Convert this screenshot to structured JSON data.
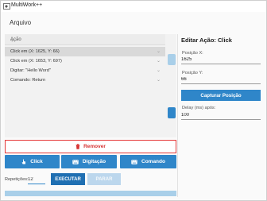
{
  "window": {
    "title": "MultiWork++"
  },
  "menu": {
    "arquivo": "Arquivo"
  },
  "list": {
    "header": "Ação",
    "items": [
      {
        "label": "Click em (X: 1625, Y: 66)",
        "selected": true
      },
      {
        "label": "Click em (X: 1653, Y: 697)",
        "selected": false
      },
      {
        "label": "Digitar: \"Hello Word\"",
        "selected": false
      },
      {
        "label": "Comando: Return",
        "selected": false
      }
    ]
  },
  "actions": {
    "remover": "Remover",
    "click": "Click",
    "digitacao": "Digitação",
    "comando": "Comando"
  },
  "run": {
    "repeticoes_label": "Repetições:",
    "repeticoes_value": "12",
    "executar": "EXECUTAR",
    "parar": "PARAR"
  },
  "editor": {
    "title": "Editar Ação: Click",
    "pos_x_label": "Posição X:",
    "pos_x_value": "1625",
    "pos_y_label": "Posição Y:",
    "pos_y_value": "66",
    "capturar": "Capturar Posição",
    "delay_label": "Delay (ms) após:",
    "delay_value": "100"
  },
  "colors": {
    "accent": "#2f86c9",
    "accent_dark": "#1f6fb2",
    "danger": "#d63333"
  }
}
